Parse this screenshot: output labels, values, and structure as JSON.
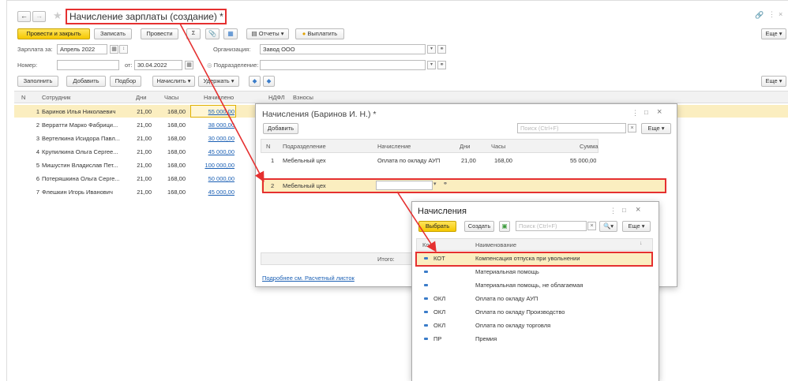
{
  "main": {
    "title": "Начисление зарплаты (создание) *",
    "toolbar": {
      "post_close": "Провести и закрыть",
      "save": "Записать",
      "post": "Провести",
      "reports": "Отчеты",
      "pay": "Выплатить",
      "more": "Еще"
    },
    "fields": {
      "period_label": "Зарплата за:",
      "period_value": "Апрель 2022",
      "org_label": "Организация:",
      "org_value": "Завод ООО",
      "number_label": "Номер:",
      "date_from_label": "от:",
      "date_value": "30.04.2022",
      "dept_label": "Подразделение:"
    },
    "toolbar2": {
      "fill": "Заполнить",
      "add": "Добавить",
      "select": "Подбор",
      "accrue": "Начислить",
      "withhold": "Удержать",
      "more": "Еще"
    },
    "table": {
      "headers": {
        "n": "N",
        "employee": "Сотрудник",
        "days": "Дни",
        "hours": "Часы",
        "accrued": "Начислено",
        "ndfl": "НДФЛ",
        "contrib": "Взносы"
      },
      "rows": [
        {
          "n": "1",
          "employee": "Баринов Илья Николаевич",
          "days": "21,00",
          "hours": "168,00",
          "accrued": "55 000,00"
        },
        {
          "n": "2",
          "employee": "Верратти Марко Фабрици...",
          "days": "21,00",
          "hours": "168,00",
          "accrued": "38 000,00"
        },
        {
          "n": "3",
          "employee": "Вертелкина Исидора Павл...",
          "days": "21,00",
          "hours": "168,00",
          "accrued": "30 000,00"
        },
        {
          "n": "4",
          "employee": "Крупилкина Ольга Сергее...",
          "days": "21,00",
          "hours": "168,00",
          "accrued": "45 000,00"
        },
        {
          "n": "5",
          "employee": "Мишустин Владислав Пет...",
          "days": "21,00",
          "hours": "168,00",
          "accrued": "100 000,00"
        },
        {
          "n": "6",
          "employee": "Потеряшкина Ольга Серге...",
          "days": "21,00",
          "hours": "168,00",
          "accrued": "50 000,00"
        },
        {
          "n": "7",
          "employee": "Флешкин Игорь Иванович",
          "days": "21,00",
          "hours": "168,00",
          "accrued": "45 000,00"
        }
      ]
    }
  },
  "dialog1": {
    "title": "Начисления (Баринов И. Н.) *",
    "add": "Добавить",
    "search_placeholder": "Поиск (Ctrl+F)",
    "more": "Еще",
    "headers": {
      "n": "N",
      "dept": "Подразделение",
      "accrual": "Начисление",
      "days": "Дни",
      "hours": "Часы",
      "sum": "Сумма"
    },
    "rows": [
      {
        "n": "1",
        "dept": "Мебельный цех",
        "accrual": "Оплата по окладу АУП",
        "days": "21,00",
        "hours": "168,00",
        "sum": "55 000,00"
      },
      {
        "n": "2",
        "dept": "Мебельный цех",
        "accrual": "",
        "days": "",
        "hours": "",
        "sum": ""
      }
    ],
    "total_label": "Итого:",
    "link": "Подробнее см. Расчетный листок"
  },
  "dialog2": {
    "title": "Начисления",
    "choose": "Выбрать",
    "create": "Создать",
    "search_placeholder": "Поиск (Ctrl+F)",
    "more": "Еще",
    "headers": {
      "code": "Код",
      "name": "Наименование"
    },
    "rows": [
      {
        "code": "КОТ",
        "name": "Компенсация отпуска при увольнении"
      },
      {
        "code": "",
        "name": "Материальная помощь"
      },
      {
        "code": "",
        "name": "Материальная помощь, не облагаемая"
      },
      {
        "code": "ОКЛ",
        "name": "Оплата по окладу АУП"
      },
      {
        "code": "ОКЛ",
        "name": "Оплата по окладу Производство"
      },
      {
        "code": "ОКЛ",
        "name": "Оплата по окладу торговля"
      },
      {
        "code": "ПР",
        "name": "Премия"
      }
    ]
  },
  "colors": {
    "highlight_red": "#e53030",
    "accent_yellow": "#f5c800",
    "link_blue": "#1a5fb4",
    "selected_row": "#fbeec0"
  }
}
